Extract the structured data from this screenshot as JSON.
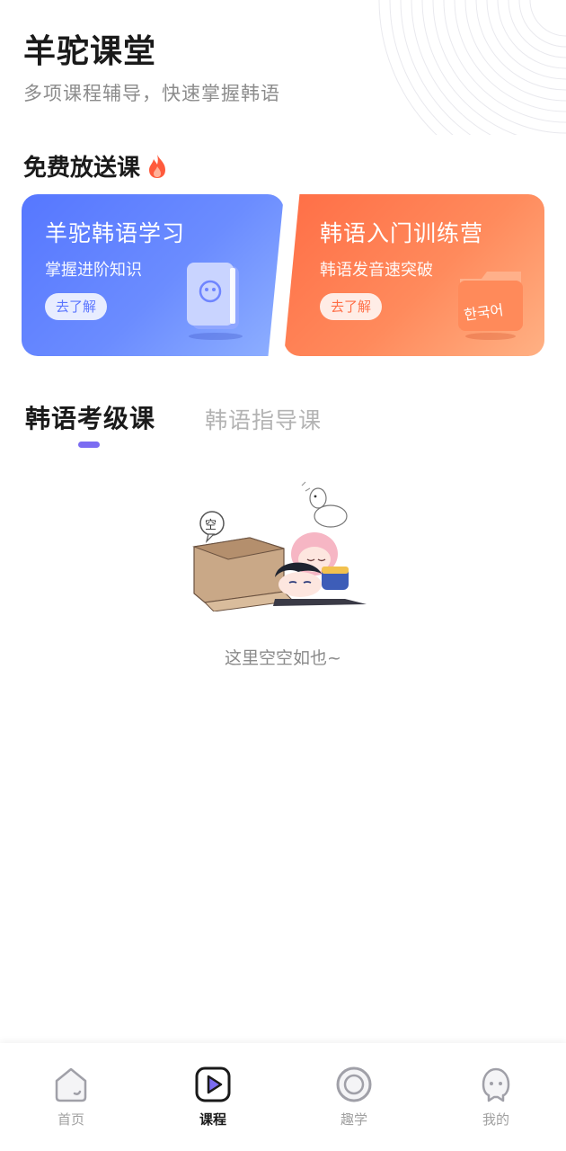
{
  "header": {
    "title": "羊驼课堂",
    "subtitle": "多项课程辅导，快速掌握韩语"
  },
  "free_section": {
    "title": "免费放送课",
    "icon": "fire-icon",
    "cards": [
      {
        "title": "羊驼韩语学习",
        "subtitle": "掌握进阶知识",
        "button": "去了解",
        "color": "#5a75ff"
      },
      {
        "title": "韩语入门训练营",
        "subtitle": "韩语发音速突破",
        "button": "去了解",
        "color": "#ff7a4d",
        "art_text": "한국어"
      }
    ]
  },
  "tabs": [
    {
      "label": "韩语考级课",
      "active": true
    },
    {
      "label": "韩语指导课",
      "active": false
    }
  ],
  "accent": "#7b6cf2",
  "empty_state": {
    "bubble_text": "空",
    "text": "这里空空如也~"
  },
  "tabbar": [
    {
      "label": "首页",
      "icon": "home-icon",
      "active": false
    },
    {
      "label": "课程",
      "icon": "course-play-icon",
      "active": true
    },
    {
      "label": "趣学",
      "icon": "circle-icon",
      "active": false
    },
    {
      "label": "我的",
      "icon": "profile-ghost-icon",
      "active": false
    }
  ]
}
